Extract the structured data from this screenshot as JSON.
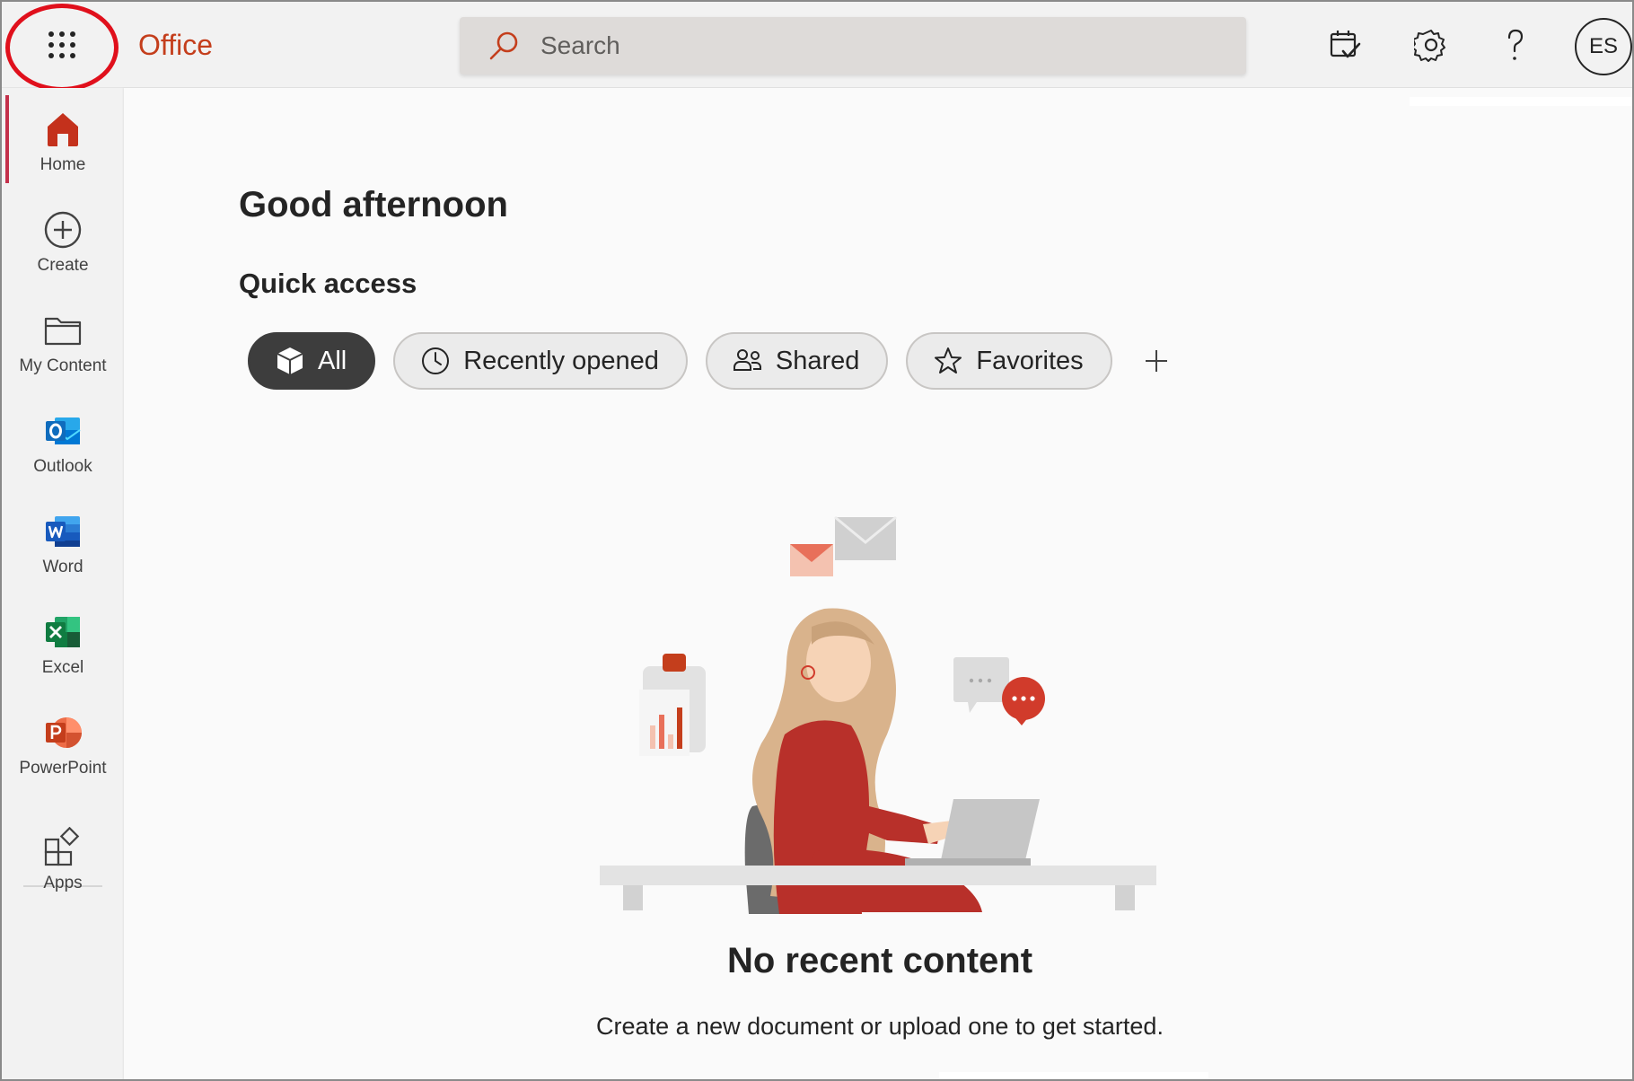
{
  "header": {
    "brand": "Office",
    "search_placeholder": "Search",
    "avatar_initials": "ES",
    "icons": [
      "app-launcher-icon",
      "search-icon",
      "calendar-check-icon",
      "gear-icon",
      "help-icon"
    ]
  },
  "sidebar": {
    "items": [
      {
        "label": "Home",
        "icon": "home-icon"
      },
      {
        "label": "Create",
        "icon": "plus-circle-icon"
      },
      {
        "label": "My Content",
        "icon": "folder-icon"
      },
      {
        "label": "Outlook",
        "icon": "outlook-icon"
      },
      {
        "label": "Word",
        "icon": "word-icon"
      },
      {
        "label": "Excel",
        "icon": "excel-icon"
      },
      {
        "label": "PowerPoint",
        "icon": "powerpoint-icon"
      },
      {
        "label": "Apps",
        "icon": "apps-icon"
      }
    ],
    "active": "Home"
  },
  "main": {
    "greeting": "Good afternoon",
    "quick_access_heading": "Quick access",
    "filters": [
      {
        "label": "All",
        "icon": "cube-icon",
        "active": true
      },
      {
        "label": "Recently opened",
        "icon": "clock-icon",
        "active": false
      },
      {
        "label": "Shared",
        "icon": "people-icon",
        "active": false
      },
      {
        "label": "Favorites",
        "icon": "star-icon",
        "active": false
      }
    ],
    "empty_state": {
      "title": "No recent content",
      "subtitle": "Create a new document or upload one to get started."
    }
  },
  "colors": {
    "brand": "#c43e1c",
    "active_pill": "#3d3d3d",
    "annotation_circle": "#e0101c",
    "outlook": "#0f6cbd",
    "word": "#185abd",
    "excel": "#107c41",
    "powerpoint": "#c43e1c"
  }
}
